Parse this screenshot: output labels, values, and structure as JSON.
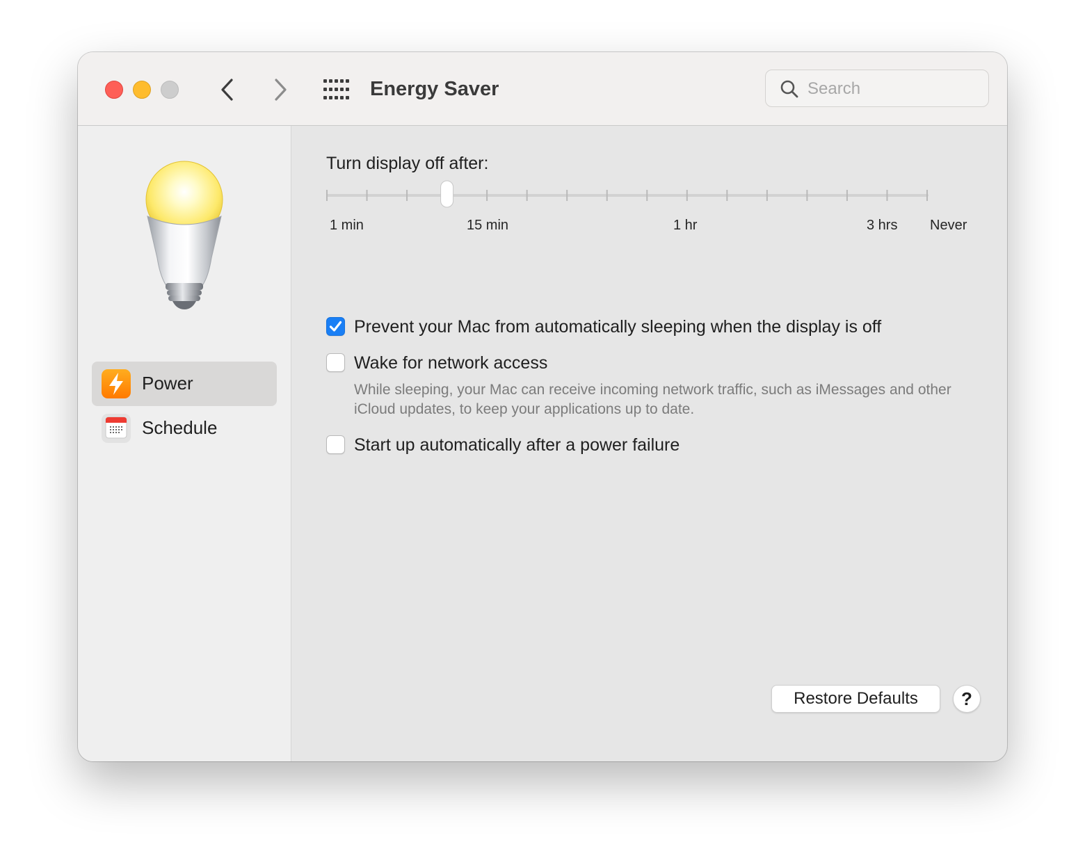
{
  "window": {
    "title": "Energy Saver",
    "traffic_lights": {
      "close": "#fe5f57",
      "minimize": "#febc2e",
      "zoom": "#cdcdcd"
    }
  },
  "toolbar": {
    "back_icon": "chevron-left-icon",
    "forward_icon": "chevron-right-icon",
    "show_all_icon": "grid-icon"
  },
  "search": {
    "placeholder": "Search",
    "value": ""
  },
  "sidebar": {
    "header_icon": "light-bulb-icon",
    "items": [
      {
        "label": "Power",
        "icon": "lightning-bolt-icon",
        "selected": true
      },
      {
        "label": "Schedule",
        "icon": "calendar-icon",
        "selected": false
      }
    ]
  },
  "display_slider": {
    "heading": "Turn display off after:",
    "labels": [
      "1 min",
      "15 min",
      "1 hr",
      "3 hrs",
      "Never"
    ],
    "tick_count": 16,
    "selected_tick_index": 3,
    "selected_label": "10 min"
  },
  "options": [
    {
      "label": "Prevent your Mac from automatically sleeping when the display is off",
      "checked": true
    },
    {
      "label": "Wake for network access",
      "checked": false,
      "help": "While sleeping, your Mac can receive incoming network traffic, such as iMessages and other iCloud updates, to keep your applications up to date."
    },
    {
      "label": "Start up automatically after a power failure",
      "checked": false
    }
  ],
  "footer": {
    "restore_label": "Restore Defaults",
    "help_label": "?"
  },
  "colors": {
    "accent": "#1a7ff5",
    "sidebar_selected": "#d9d8d7",
    "power_icon": "#ff9500"
  }
}
